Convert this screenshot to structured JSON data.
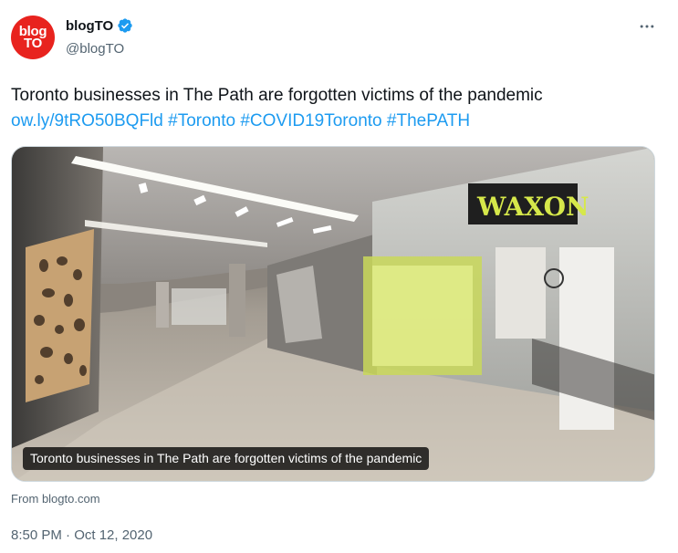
{
  "author": {
    "avatar_text_line1": "blog",
    "avatar_text_line2": "TO",
    "display_name": "blogTO",
    "handle": "@blogTO",
    "verified_icon": "verified-badge-icon",
    "brand_color": "#e8231e"
  },
  "menu": {
    "icon": "more-horizontal-icon"
  },
  "tweet": {
    "text": "Toronto businesses in The Path are forgotten victims of the pandemic",
    "link": "ow.ly/9tRO50BQFld",
    "hashtags": [
      "#Toronto",
      "#COVID19Toronto",
      "#ThePATH"
    ],
    "link_color": "#1d9bf0"
  },
  "card": {
    "store_sign": "WAXON",
    "store_sign_small": "WAX",
    "caption": "Toronto businesses in The Path are forgotten victims of the pandemic",
    "source": "From blogto.com"
  },
  "timestamp": "8:50 PM · Oct 12, 2020"
}
